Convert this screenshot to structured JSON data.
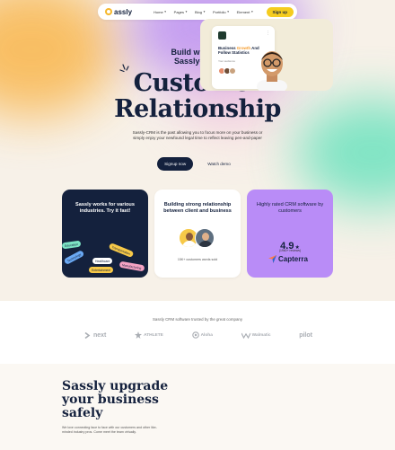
{
  "nav": {
    "logo": "assly",
    "items": [
      {
        "label": "Home"
      },
      {
        "label": "Pages"
      },
      {
        "label": "Blog"
      },
      {
        "label": "Portfolio"
      },
      {
        "label": "Element"
      }
    ],
    "signup": "Sign up"
  },
  "hero": {
    "kicker_line1": "Build with the",
    "kicker_line2": "Sassly-CRM",
    "title_line1": "Customer",
    "title_line2": "Relationship",
    "description": "Sassly-CRM is the past allowing you to focus more on your business or simply enjoy your newfound legal time to reflect leaving pen-and-paper",
    "primary_button": "Signup now",
    "secondary_button": "Watch demo"
  },
  "cards": {
    "industries": {
      "title": "Sassly works for various industries. Try it fast!",
      "pills": [
        "Education",
        "Transportation",
        "Healthcare",
        "Entertainment",
        "Manufacturing",
        "Technology"
      ]
    },
    "relationship": {
      "title": "Building strong relationship between client and business",
      "note": "15K+ customers words sold"
    },
    "rating": {
      "title": "Highly rated CRM software by customers",
      "score": "4.9",
      "reviews": "(1960+ reviews)",
      "brand": "Capterra"
    }
  },
  "partners": {
    "caption": "Sassly CRM software trusted by the great company",
    "logos": [
      {
        "name": "next",
        "icon": "chevron-logo-icon"
      },
      {
        "name": "ATHLETE",
        "icon": "star-logo-icon"
      },
      {
        "name": "Aloha",
        "icon": "swirl-logo-icon"
      },
      {
        "name": "Walmatic",
        "icon": "wave-logo-icon"
      },
      {
        "name": "pilot",
        "icon": "none"
      }
    ]
  },
  "feature": {
    "title": "Sassly upgrade your business safely",
    "description": "We love connecting face to face with our customers and other like-minded industry pros. Come meet the team virtually.",
    "dashboard": {
      "text_before": "Business ",
      "highlight": "Growth",
      "text_after": " And Follow Statistics",
      "sub": "Your audience"
    }
  },
  "colors": {
    "navy": "#14213d",
    "accent_yellow": "#f5cc1f",
    "purple_card": "#b98cf7",
    "capterra_orange": "#ff7a45",
    "capterra_blue": "#2b65d9"
  }
}
